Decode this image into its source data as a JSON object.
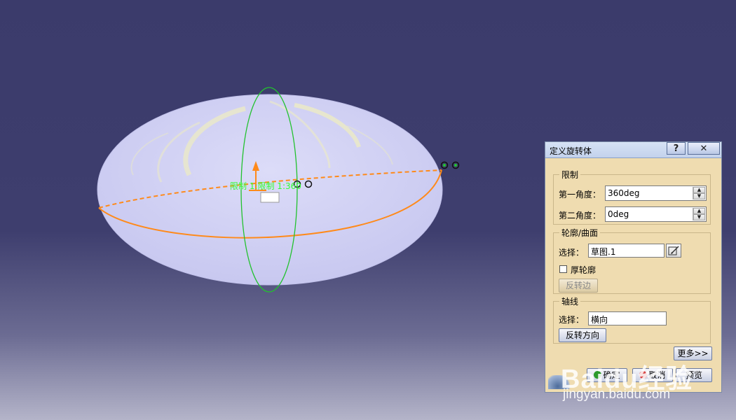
{
  "viewport": {
    "overlay_label": "限制 1:限制 1:360"
  },
  "dialog": {
    "title": "定义旋转体",
    "help_label": "?",
    "close_label": "✕",
    "limits": {
      "group_title": "限制",
      "first_angle_label": "第一角度：",
      "first_angle_value": "360deg",
      "second_angle_label": "第二角度：",
      "second_angle_value": "0deg"
    },
    "profile": {
      "group_title": "轮廓/曲面",
      "select_label": "选择：",
      "select_value": "草图.1",
      "thick_profile_label": "厚轮廓",
      "reverse_side_label": "反转边"
    },
    "axis": {
      "group_title": "轴线",
      "select_label": "选择：",
      "select_value": "横向",
      "reverse_direction_label": "反转方向"
    },
    "more_label": "更多>>",
    "ok_label": "确定",
    "cancel_label": "取消",
    "preview_label": "预览"
  },
  "watermark": {
    "brand": "Baidu经验",
    "url": "jingyan.baidu.com"
  },
  "colors": {
    "background_top": "#3b3b6b",
    "ellipsoid_fill": "#d2d2f5",
    "profile_orange": "#ff8a1a",
    "axis_green": "#22c22e",
    "dialog_bg": "#efdcb0"
  }
}
